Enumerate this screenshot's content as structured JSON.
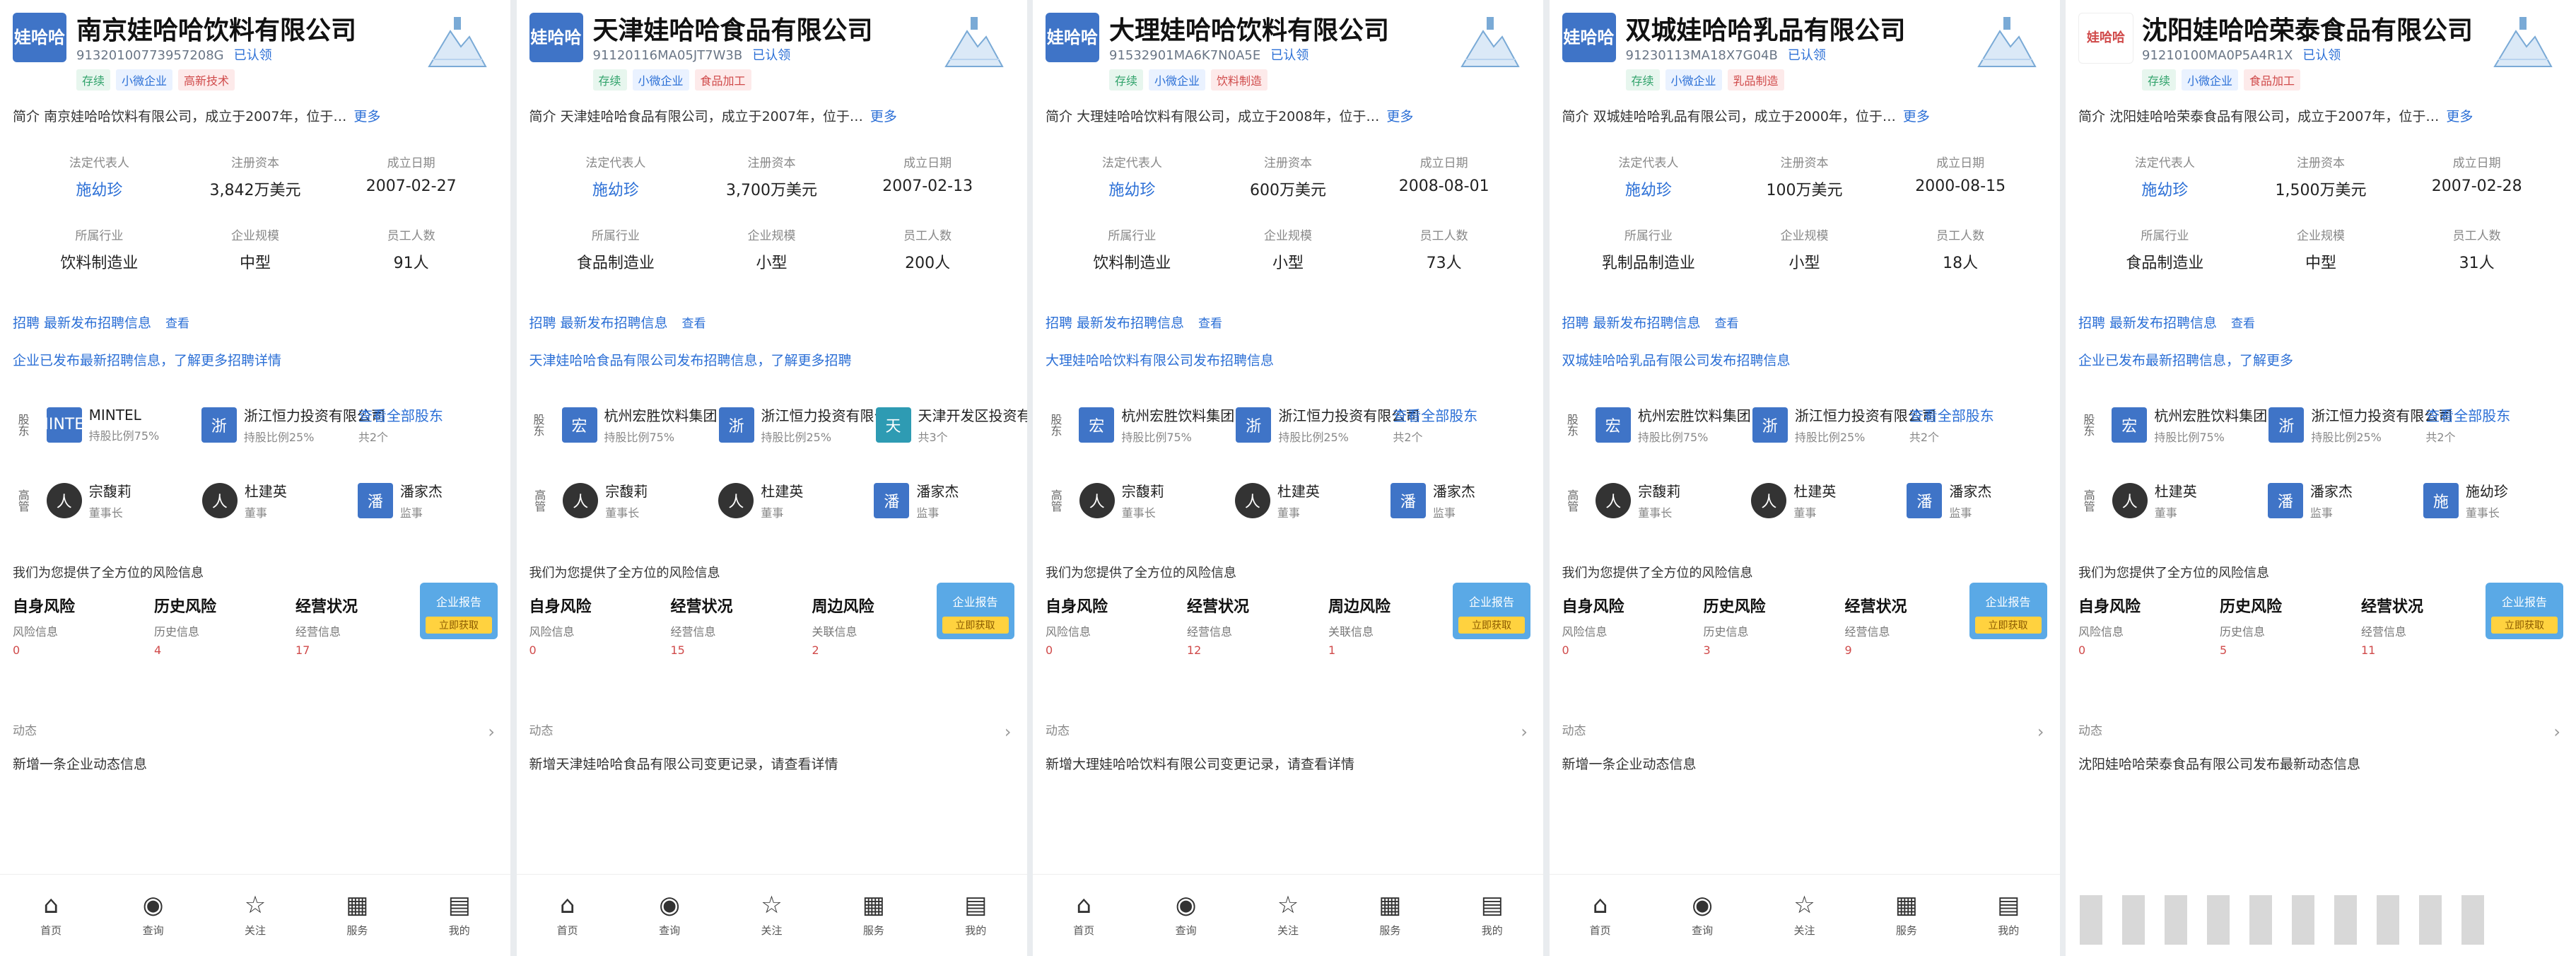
{
  "panels": [
    {
      "logo": "娃哈哈",
      "logo_style": "blue",
      "company": "南京娃哈哈饮料有限公司",
      "credit_code": "91320100773957208G",
      "badge": "已认领",
      "tags": [
        "存续",
        "小微企业",
        "高新技术"
      ],
      "intro_label": "简介",
      "intro": "南京娃哈哈饮料有限公司，成立于2007年，位于…",
      "more": "更多",
      "info": [
        {
          "label": "法定代表人",
          "value": "施幼珍",
          "link": true
        },
        {
          "label": "注册资本",
          "value": "3,842万美元",
          "link": false
        },
        {
          "label": "成立日期",
          "value": "2007-02-27",
          "link": false
        },
        {
          "label": "所属行业",
          "value": "饮料制造业",
          "link": false
        },
        {
          "label": "企业规模",
          "value": "中型",
          "link": false
        },
        {
          "label": "员工人数",
          "value": "91人",
          "link": false
        }
      ],
      "news_line1": "招聘 最新发布招聘信息",
      "news_tag": "查看",
      "news_line2": "企业已发布最新招聘信息，了解更多招聘详情",
      "relations": [
        {
          "side": "股东",
          "items": [
            {
              "icon": "MINTEL",
              "style": "blue",
              "t1": "MINTEL",
              "t2": "持股比例75%"
            },
            {
              "icon": "浙",
              "style": "blue",
              "t1": "浙江恒力投资有限公司",
              "t2": "持股比例25%"
            },
            {
              "icon": "",
              "style": "",
              "t1": "查看全部股东",
              "t2": "共2个"
            }
          ]
        },
        {
          "side": "高管",
          "items": [
            {
              "icon": "人",
              "style": "person",
              "t1": "宗馥莉",
              "t2": "董事长"
            },
            {
              "icon": "人",
              "style": "person",
              "t1": "杜建英",
              "t2": "董事"
            },
            {
              "icon": "潘",
              "style": "blue",
              "t1": "潘家杰",
              "t2": "监事"
            }
          ]
        }
      ],
      "risk_label": "我们为您提供了全方位的风险信息",
      "risks": [
        {
          "title": "自身风险",
          "sub": "风险信息",
          "num": "0"
        },
        {
          "title": "历史风险",
          "sub": "历史信息",
          "num": "4"
        },
        {
          "title": "经营状况",
          "sub": "经营信息",
          "num": "17"
        }
      ],
      "promo_title": "企业报告",
      "promo_btn": "立即获取",
      "dyn_label": "动态",
      "dyn_text": "新增一条企业动态信息",
      "nav": [
        {
          "icon": "⌂",
          "label": "首页"
        },
        {
          "icon": "◉",
          "label": "查询"
        },
        {
          "icon": "☆",
          "label": "关注"
        },
        {
          "icon": "▦",
          "label": "服务"
        },
        {
          "icon": "▤",
          "label": "我的"
        }
      ]
    },
    {
      "logo": "娃哈哈",
      "logo_style": "blue",
      "company": "天津娃哈哈食品有限公司",
      "credit_code": "91120116MA05JT7W3B",
      "badge": "已认领",
      "tags": [
        "存续",
        "小微企业",
        "食品加工"
      ],
      "intro_label": "简介",
      "intro": "天津娃哈哈食品有限公司，成立于2007年，位于…",
      "more": "更多",
      "info": [
        {
          "label": "法定代表人",
          "value": "施幼珍",
          "link": true
        },
        {
          "label": "注册资本",
          "value": "3,700万美元",
          "link": false
        },
        {
          "label": "成立日期",
          "value": "2007-02-13",
          "link": false
        },
        {
          "label": "所属行业",
          "value": "食品制造业",
          "link": false
        },
        {
          "label": "企业规模",
          "value": "小型",
          "link": false
        },
        {
          "label": "员工人数",
          "value": "200人",
          "link": false
        }
      ],
      "news_line1": "招聘 最新发布招聘信息",
      "news_tag": "查看",
      "news_line2": "天津娃哈哈食品有限公司发布招聘信息，了解更多招聘",
      "relations": [
        {
          "side": "股东",
          "items": [
            {
              "icon": "宏",
              "style": "blue",
              "t1": "杭州宏胜饮料集团",
              "t2": "持股比例75%"
            },
            {
              "icon": "浙",
              "style": "blue",
              "t1": "浙江恒力投资有限公司",
              "t2": "持股比例25%"
            },
            {
              "icon": "天",
              "style": "teal",
              "t1": "天津开发区投资有限公司",
              "t2": "共3个"
            }
          ]
        },
        {
          "side": "高管",
          "items": [
            {
              "icon": "人",
              "style": "person",
              "t1": "宗馥莉",
              "t2": "董事长"
            },
            {
              "icon": "人",
              "style": "person",
              "t1": "杜建英",
              "t2": "董事"
            },
            {
              "icon": "潘",
              "style": "blue",
              "t1": "潘家杰",
              "t2": "监事"
            }
          ]
        }
      ],
      "risk_label": "我们为您提供了全方位的风险信息",
      "risks": [
        {
          "title": "自身风险",
          "sub": "风险信息",
          "num": "0"
        },
        {
          "title": "经营状况",
          "sub": "经营信息",
          "num": "15"
        },
        {
          "title": "周边风险",
          "sub": "关联信息",
          "num": "2"
        }
      ],
      "promo_title": "企业报告",
      "promo_btn": "立即获取",
      "dyn_label": "动态",
      "dyn_text": "新增天津娃哈哈食品有限公司变更记录，请查看详情",
      "nav": [
        {
          "icon": "⌂",
          "label": "首页"
        },
        {
          "icon": "◉",
          "label": "查询"
        },
        {
          "icon": "☆",
          "label": "关注"
        },
        {
          "icon": "▦",
          "label": "服务"
        },
        {
          "icon": "▤",
          "label": "我的"
        }
      ]
    },
    {
      "logo": "娃哈哈",
      "logo_style": "blue",
      "company": "大理娃哈哈饮料有限公司",
      "credit_code": "91532901MA6K7N0A5E",
      "badge": "已认领",
      "tags": [
        "存续",
        "小微企业",
        "饮料制造"
      ],
      "intro_label": "简介",
      "intro": "大理娃哈哈饮料有限公司，成立于2008年，位于…",
      "more": "更多",
      "info": [
        {
          "label": "法定代表人",
          "value": "施幼珍",
          "link": true
        },
        {
          "label": "注册资本",
          "value": "600万美元",
          "link": false
        },
        {
          "label": "成立日期",
          "value": "2008-08-01",
          "link": false
        },
        {
          "label": "所属行业",
          "value": "饮料制造业",
          "link": false
        },
        {
          "label": "企业规模",
          "value": "小型",
          "link": false
        },
        {
          "label": "员工人数",
          "value": "73人",
          "link": false
        }
      ],
      "news_line1": "招聘 最新发布招聘信息",
      "news_tag": "查看",
      "news_line2": "大理娃哈哈饮料有限公司发布招聘信息",
      "relations": [
        {
          "side": "股东",
          "items": [
            {
              "icon": "宏",
              "style": "blue",
              "t1": "杭州宏胜饮料集团",
              "t2": "持股比例75%"
            },
            {
              "icon": "浙",
              "style": "blue",
              "t1": "浙江恒力投资有限公司",
              "t2": "持股比例25%"
            },
            {
              "icon": "",
              "style": "",
              "t1": "查看全部股东",
              "t2": "共2个"
            }
          ]
        },
        {
          "side": "高管",
          "items": [
            {
              "icon": "人",
              "style": "person",
              "t1": "宗馥莉",
              "t2": "董事长"
            },
            {
              "icon": "人",
              "style": "person",
              "t1": "杜建英",
              "t2": "董事"
            },
            {
              "icon": "潘",
              "style": "blue",
              "t1": "潘家杰",
              "t2": "监事"
            }
          ]
        }
      ],
      "risk_label": "我们为您提供了全方位的风险信息",
      "risks": [
        {
          "title": "自身风险",
          "sub": "风险信息",
          "num": "0"
        },
        {
          "title": "经营状况",
          "sub": "经营信息",
          "num": "12"
        },
        {
          "title": "周边风险",
          "sub": "关联信息",
          "num": "1"
        }
      ],
      "promo_title": "企业报告",
      "promo_btn": "立即获取",
      "dyn_label": "动态",
      "dyn_text": "新增大理娃哈哈饮料有限公司变更记录，请查看详情",
      "nav": [
        {
          "icon": "⌂",
          "label": "首页"
        },
        {
          "icon": "◉",
          "label": "查询"
        },
        {
          "icon": "☆",
          "label": "关注"
        },
        {
          "icon": "▦",
          "label": "服务"
        },
        {
          "icon": "▤",
          "label": "我的"
        }
      ]
    },
    {
      "logo": "娃哈哈",
      "logo_style": "blue",
      "company": "双城娃哈哈乳品有限公司",
      "credit_code": "91230113MA18X7G04B",
      "badge": "已认领",
      "tags": [
        "存续",
        "小微企业",
        "乳品制造"
      ],
      "intro_label": "简介",
      "intro": "双城娃哈哈乳品有限公司，成立于2000年，位于…",
      "more": "更多",
      "info": [
        {
          "label": "法定代表人",
          "value": "施幼珍",
          "link": true
        },
        {
          "label": "注册资本",
          "value": "100万美元",
          "link": false
        },
        {
          "label": "成立日期",
          "value": "2000-08-15",
          "link": false
        },
        {
          "label": "所属行业",
          "value": "乳制品制造业",
          "link": false
        },
        {
          "label": "企业规模",
          "value": "小型",
          "link": false
        },
        {
          "label": "员工人数",
          "value": "18人",
          "link": false
        }
      ],
      "news_line1": "招聘 最新发布招聘信息",
      "news_tag": "查看",
      "news_line2": "双城娃哈哈乳品有限公司发布招聘信息",
      "relations": [
        {
          "side": "股东",
          "items": [
            {
              "icon": "宏",
              "style": "blue",
              "t1": "杭州宏胜饮料集团",
              "t2": "持股比例75%"
            },
            {
              "icon": "浙",
              "style": "blue",
              "t1": "浙江恒力投资有限公司",
              "t2": "持股比例25%"
            },
            {
              "icon": "",
              "style": "",
              "t1": "查看全部股东",
              "t2": "共2个"
            }
          ]
        },
        {
          "side": "高管",
          "items": [
            {
              "icon": "人",
              "style": "person",
              "t1": "宗馥莉",
              "t2": "董事长"
            },
            {
              "icon": "人",
              "style": "person",
              "t1": "杜建英",
              "t2": "董事"
            },
            {
              "icon": "潘",
              "style": "blue",
              "t1": "潘家杰",
              "t2": "监事"
            }
          ]
        }
      ],
      "risk_label": "我们为您提供了全方位的风险信息",
      "risks": [
        {
          "title": "自身风险",
          "sub": "风险信息",
          "num": "0"
        },
        {
          "title": "历史风险",
          "sub": "历史信息",
          "num": "3"
        },
        {
          "title": "经营状况",
          "sub": "经营信息",
          "num": "9"
        }
      ],
      "promo_title": "企业报告",
      "promo_btn": "立即获取",
      "dyn_label": "动态",
      "dyn_text": "新增一条企业动态信息",
      "nav": [
        {
          "icon": "⌂",
          "label": "首页"
        },
        {
          "icon": "◉",
          "label": "查询"
        },
        {
          "icon": "☆",
          "label": "关注"
        },
        {
          "icon": "▦",
          "label": "服务"
        },
        {
          "icon": "▤",
          "label": "我的"
        }
      ]
    },
    {
      "logo": "娃哈哈",
      "logo_style": "red",
      "company": "沈阳娃哈哈荣泰食品有限公司",
      "credit_code": "91210100MA0P5A4R1X",
      "badge": "已认领",
      "tags": [
        "存续",
        "小微企业",
        "食品加工"
      ],
      "intro_label": "简介",
      "intro": "沈阳娃哈哈荣泰食品有限公司，成立于2007年，位于…",
      "more": "更多",
      "info": [
        {
          "label": "法定代表人",
          "value": "施幼珍",
          "link": true
        },
        {
          "label": "注册资本",
          "value": "1,500万美元",
          "link": false
        },
        {
          "label": "成立日期",
          "value": "2007-02-28",
          "link": false
        },
        {
          "label": "所属行业",
          "value": "食品制造业",
          "link": false
        },
        {
          "label": "企业规模",
          "value": "中型",
          "link": false
        },
        {
          "label": "员工人数",
          "value": "31人",
          "link": false
        }
      ],
      "news_line1": "招聘 最新发布招聘信息",
      "news_tag": "查看",
      "news_line2": "企业已发布最新招聘信息，了解更多",
      "relations": [
        {
          "side": "股东",
          "items": [
            {
              "icon": "宏",
              "style": "blue",
              "t1": "杭州宏胜饮料集团",
              "t2": "持股比例75%"
            },
            {
              "icon": "浙",
              "style": "blue",
              "t1": "浙江恒力投资有限公司",
              "t2": "持股比例25%"
            },
            {
              "icon": "",
              "style": "",
              "t1": "查看全部股东",
              "t2": "共2个"
            }
          ]
        },
        {
          "side": "高管",
          "items": [
            {
              "icon": "人",
              "style": "person",
              "t1": "杜建英",
              "t2": "董事"
            },
            {
              "icon": "潘",
              "style": "blue",
              "t1": "潘家杰",
              "t2": "监事"
            },
            {
              "icon": "施",
              "style": "blue",
              "t1": "施幼珍",
              "t2": "董事长"
            }
          ]
        }
      ],
      "risk_label": "我们为您提供了全方位的风险信息",
      "risks": [
        {
          "title": "自身风险",
          "sub": "风险信息",
          "num": "0"
        },
        {
          "title": "历史风险",
          "sub": "历史信息",
          "num": "5"
        },
        {
          "title": "经营状况",
          "sub": "经营信息",
          "num": "11"
        }
      ],
      "promo_title": "企业报告",
      "promo_btn": "立即获取",
      "dyn_label": "动态",
      "dyn_text": "沈阳娃哈哈荣泰食品有限公司发布最新动态信息",
      "nav": []
    }
  ]
}
